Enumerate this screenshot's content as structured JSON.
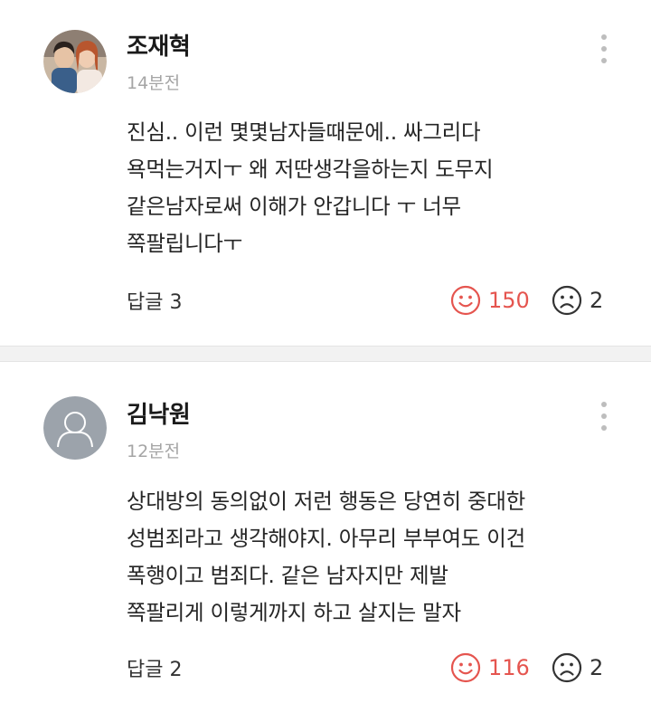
{
  "comments": [
    {
      "author": "조재혁",
      "time": "14분전",
      "lines": [
        "진심.. 이런 몇몇남자들때문에.. 싸그리다",
        "욕먹는거지ㅜ 왜 저딴생각을하는지 도무지",
        "같은남자로써 이해가 안갑니다 ㅜ 너무",
        "쪽팔립니다ㅜ"
      ],
      "reply_label": "답글 3",
      "likes": "150",
      "dislikes": "2"
    },
    {
      "author": "김낙원",
      "time": "12분전",
      "lines": [
        "상대방의 동의없이 저런 행동은 당연히 중대한",
        "성범죄라고 생각해야지. 아무리 부부여도 이건",
        "폭행이고 범죄다. 같은 남자지만 제발",
        "쪽팔리게 이렇게까지 하고 살지는 말자"
      ],
      "reply_label": "답글 2",
      "likes": "116",
      "dislikes": "2"
    }
  ],
  "colors": {
    "like": "#e5554f",
    "dislike": "#333333",
    "meta": "#a5a5a5",
    "separator": "#f2f2f2"
  },
  "icons": {
    "like": "smile-icon",
    "dislike": "frown-icon",
    "more": "more-vertical-icon",
    "default_avatar": "default-user-avatar-icon"
  }
}
